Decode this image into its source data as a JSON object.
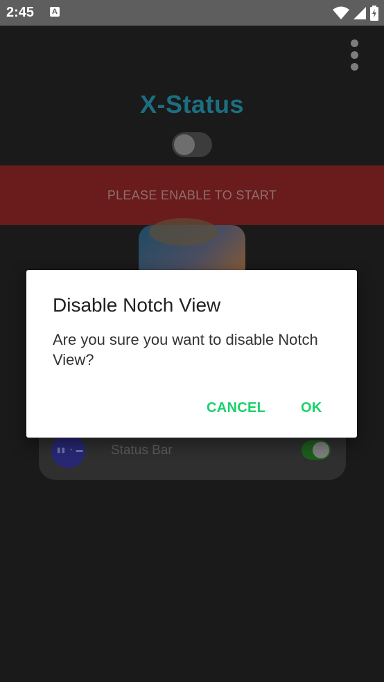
{
  "status_bar": {
    "time": "2:45",
    "notification_icon": "a-letter-icon",
    "icons": [
      "wifi-icon",
      "cell-signal-icon",
      "battery-charging-icon"
    ]
  },
  "app": {
    "title": "X-Status",
    "master_toggle_on": false,
    "banner_text": "PLEASE ENABLE TO START",
    "overflow_menu_icon": "more-vert-icon",
    "settings": [
      {
        "label": "Status Bar",
        "enabled": true,
        "icon": "status-bar-icon"
      }
    ]
  },
  "dialog": {
    "title": "Disable Notch View",
    "message": "Are you sure you want to disable Notch View?",
    "cancel_label": "CANCEL",
    "ok_label": "OK"
  },
  "colors": {
    "accent": "#19d26a",
    "banner": "#6a1b1b",
    "background": "#1a1a1a"
  }
}
